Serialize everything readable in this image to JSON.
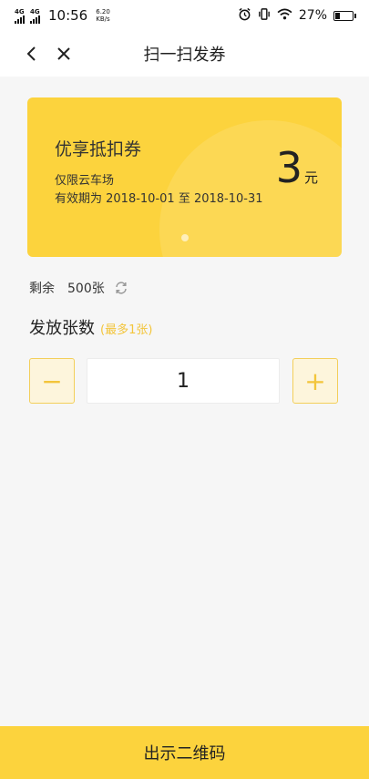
{
  "status_bar": {
    "sim1_label": "4G",
    "sim2_label": "4G",
    "time": "10:56",
    "speed_value": "6.20",
    "speed_unit": "KB/s",
    "battery_percent": "27%",
    "battery_level": 0.27,
    "icons": [
      "alarm-icon",
      "vibrate-icon",
      "wifi-icon",
      "battery-icon"
    ]
  },
  "header": {
    "title": "扫一扫发券",
    "back_icon": "back-arrow-icon",
    "close_icon": "close-icon"
  },
  "coupon": {
    "title": "优享抵扣券",
    "scope": "仅限云车场",
    "validity": "有效期为 2018-10-01 至 2018-10-31",
    "amount": "3",
    "unit": "元",
    "color": "#fcd33d"
  },
  "remaining": {
    "label": "剩余",
    "count": "500张",
    "refresh_icon": "refresh-icon"
  },
  "issue": {
    "label": "发放张数",
    "hint": "(最多1张)"
  },
  "stepper": {
    "minus_label": "−",
    "value": "1",
    "plus_label": "+"
  },
  "bottom_button": {
    "label": "出示二维码"
  },
  "colors": {
    "accent": "#fcd33d",
    "hint": "#f3c53b",
    "background": "#f6f6f6"
  }
}
